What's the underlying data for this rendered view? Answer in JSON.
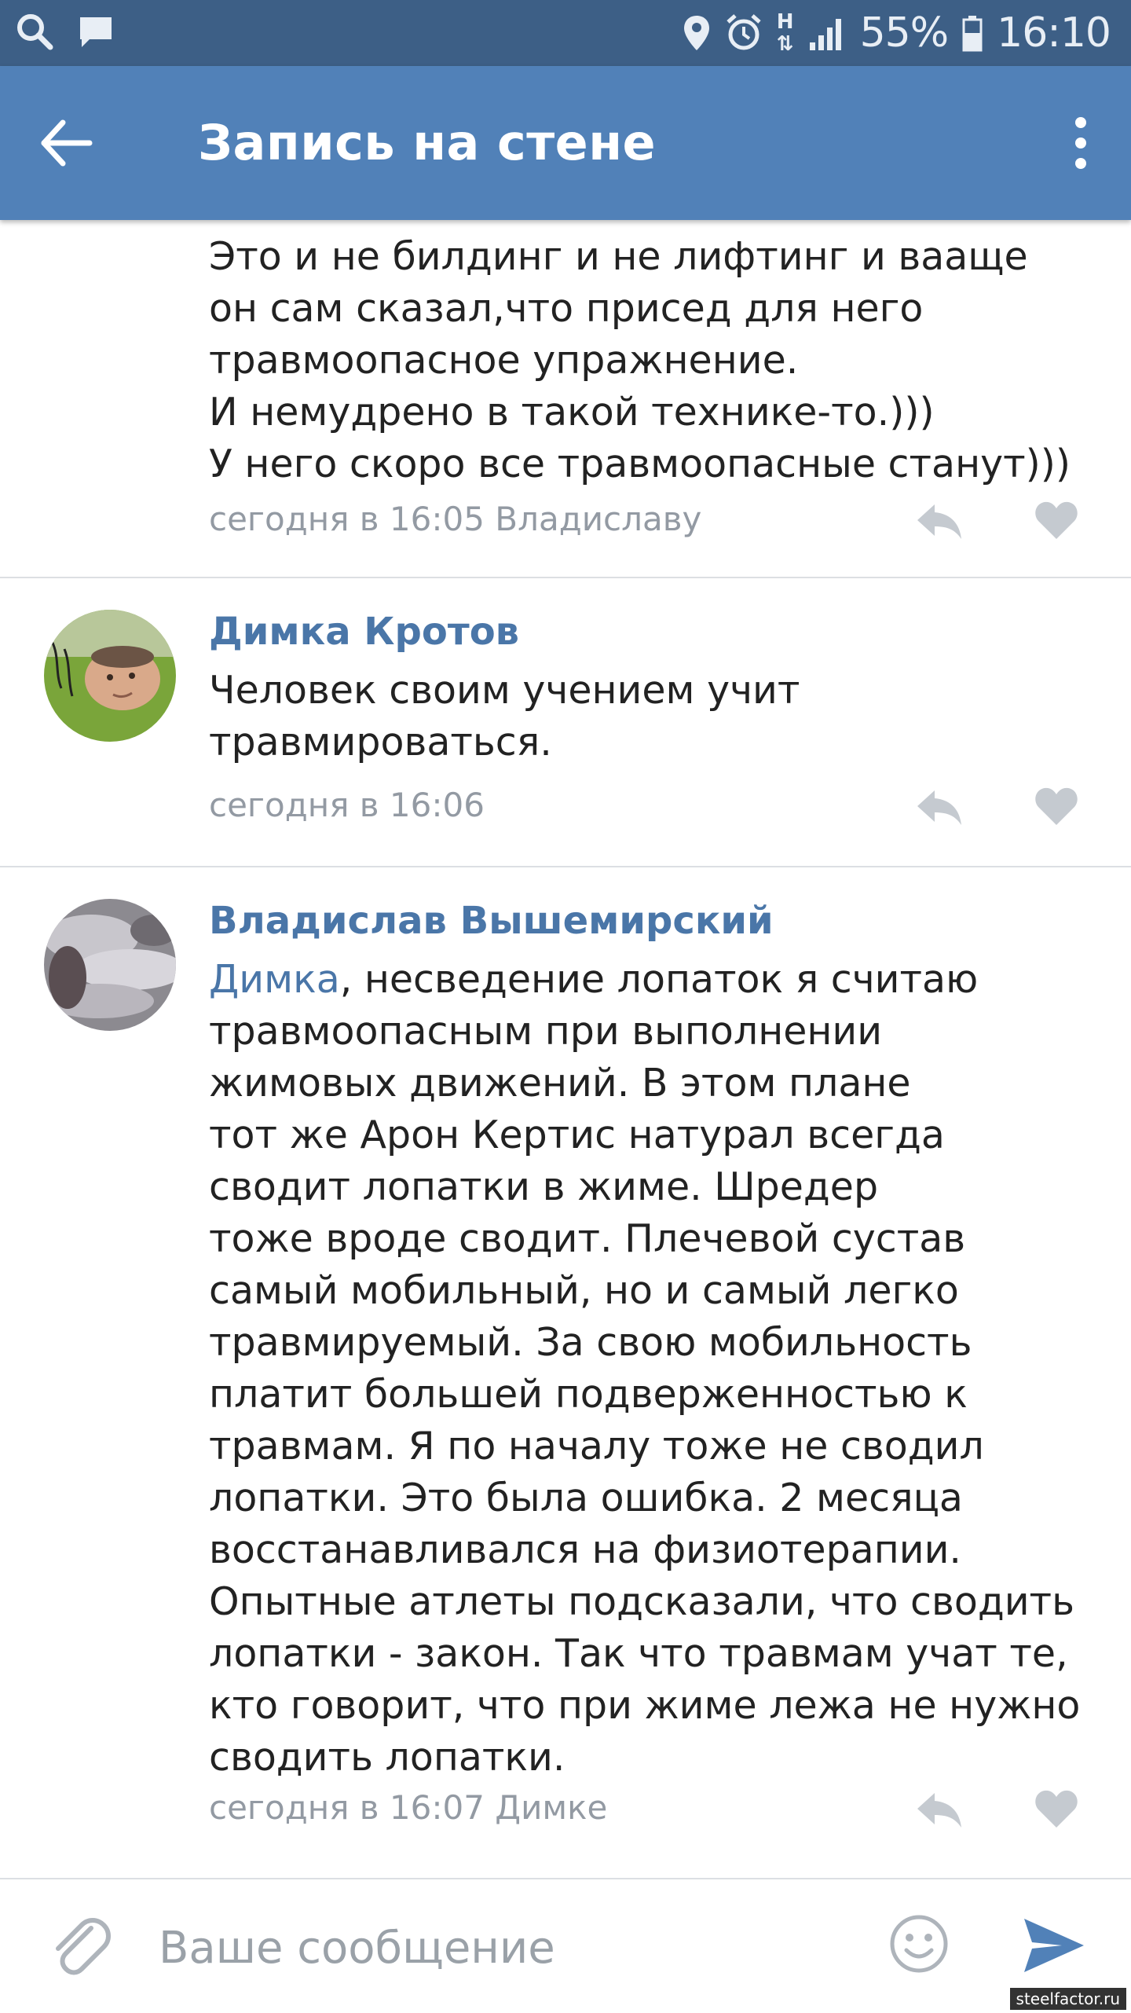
{
  "status_bar": {
    "battery": "55%",
    "time": "16:10",
    "net_label": "H",
    "icons": [
      "search-icon",
      "message-icon",
      "location-icon",
      "alarm-icon",
      "signal-icon",
      "battery-icon"
    ]
  },
  "toolbar": {
    "title": "Запись на стене",
    "icons": [
      "back-arrow-icon",
      "more-vertical-icon"
    ]
  },
  "comments": [
    {
      "name": "",
      "text": "технике.\nЭто и не билдинг и не лифтинг и вааще\nон сам сказал,что присед для него\nтравмоопасное упражнение.\nИ немудрено в такой технике-то.)))\nУ него скоро все травмоопасные станут)))",
      "meta": "сегодня в 16:05 Владиславу"
    },
    {
      "name": "Димка Кротов",
      "text": "Человек своим учением учит\nтравмироваться.",
      "meta": "сегодня в 16:06"
    },
    {
      "name": "Владислав Вышемирский",
      "mention": "Димка",
      "text": ", несведение лопаток я считаю\nтравмоопасным при выполнении\nжимовых движений. В этом плане\nтот же Арон Кертис натурал всегда\nсводит лопатки в жиме. Шредер\nтоже вроде сводит. Плечевой сустав\nсамый мобильный, но и самый легко\nтравмируемый. За свою мобильность\nплатит большей подверженностью к\nтравмам. Я по началу тоже не сводил\nлопатки. Это была ошибка. 2 месяца\nвосстанавливался на физиотерапии.\nОпытные атлеты подсказали, что сводить\nлопатки - закон. Так что травмам учат те,\nкто говорит, что при жиме лежа не нужно\nсводить лопатки.",
      "meta": "сегодня в 16:07 Димке"
    }
  ],
  "input": {
    "placeholder": "Ваше сообщение",
    "value": ""
  },
  "watermark": "steelfactor.ru",
  "colors": {
    "status_bar": "#3d5f86",
    "toolbar": "#5181b8",
    "link": "#4a76a8",
    "meta": "#939aa3",
    "icon_gray": "#c5cad0"
  }
}
